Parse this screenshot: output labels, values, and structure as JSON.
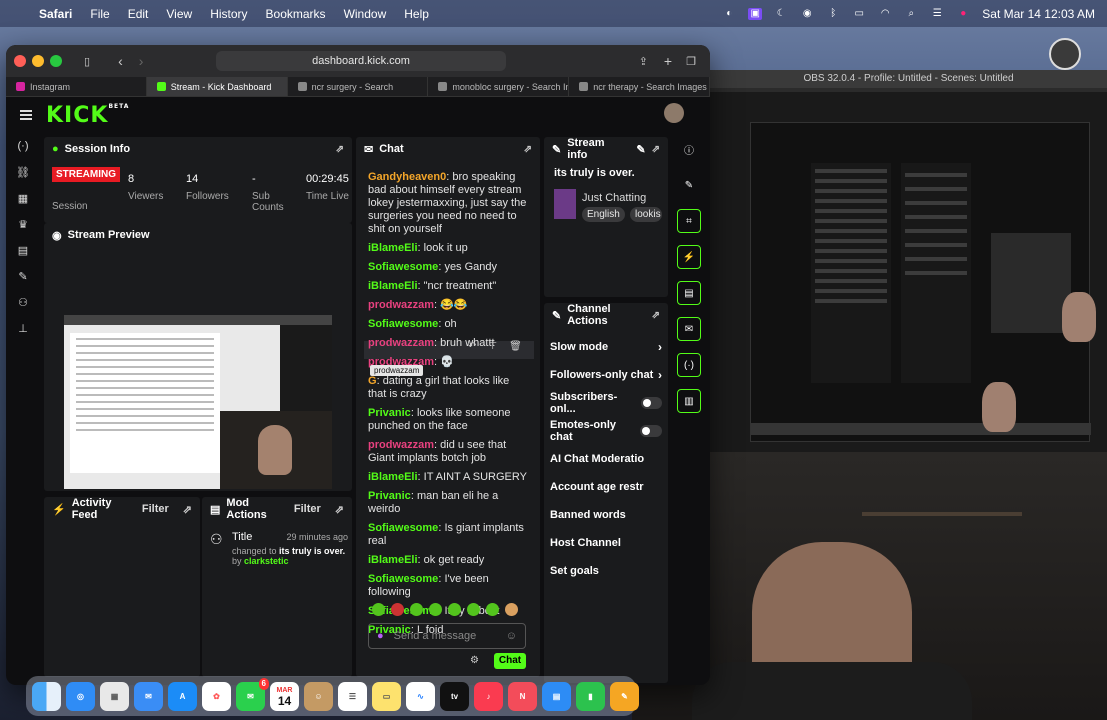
{
  "menubar": {
    "app": "Safari",
    "items": [
      "File",
      "Edit",
      "View",
      "History",
      "Bookmarks",
      "Window",
      "Help"
    ],
    "datetime": "Sat Mar 14  12:03 AM"
  },
  "safari": {
    "url": "dashboard.kick.com",
    "tabs": [
      {
        "label": "Instagram",
        "color": "#d6249f"
      },
      {
        "label": "Stream - Kick Dashboard",
        "color": "#53fc18"
      },
      {
        "label": "ncr surgery - Search",
        "color": "#888"
      },
      {
        "label": "monobloc surgery - Search Im...",
        "color": "#888"
      },
      {
        "label": "ncr therapy - Search Images",
        "color": "#888"
      }
    ]
  },
  "obs": {
    "title": "OBS 32.0.4 - Profile: Untitled - Scenes: Untitled"
  },
  "kick": {
    "logo": "KICK",
    "logo_sup": "BETA"
  },
  "session": {
    "title": "Session Info",
    "status": "STREAMING",
    "status_label": "Session",
    "viewers_value": "8",
    "viewers_label": "Viewers",
    "followers_value": "14",
    "followers_label": "Followers",
    "subs_value": "-",
    "subs_label": "Sub Counts",
    "time_value": "00:29:45",
    "time_label": "Time Live"
  },
  "preview": {
    "title": "Stream Preview"
  },
  "activity": {
    "title": "Activity Feed",
    "filter": "Filter"
  },
  "mod": {
    "title": "Mod Actions",
    "filter": "Filter",
    "item_title": "Title",
    "item_time": "29 minutes ago",
    "item_prefix": "changed to ",
    "item_value": "its truly is over.",
    "item_by_prefix": "by ",
    "item_by": "clarkstetic"
  },
  "chat": {
    "title": "Chat",
    "messages": [
      {
        "user": "Gandyheaven0",
        "color": "#f4a62a",
        "text": "bro speaking bad about himself every stream lokey jestermaxxing, just say the surgeries you need no need to shit on yourself"
      },
      {
        "user": "iBlameEli",
        "color": "#53fc18",
        "text": "look it up"
      },
      {
        "user": "Sofiawesome",
        "color": "#53fc18",
        "text": "yes Gandy"
      },
      {
        "user": "iBlameEli",
        "color": "#53fc18",
        "text": "\"ncr treatment\""
      },
      {
        "user": "prodwazzam",
        "color": "#e8417f",
        "text": "😂😂"
      },
      {
        "user": "Sofiawesome",
        "color": "#53fc18",
        "text": "oh"
      },
      {
        "user": "prodwazzam",
        "color": "#e8417f",
        "text": "bruh whattt"
      },
      {
        "user": "prodwazzam",
        "color": "#e8417f",
        "text": "💀"
      },
      {
        "user": "G",
        "color": "#f4a62a",
        "text": "dating a girl that looks like that is crazy"
      },
      {
        "user": "Privanic",
        "color": "#53fc18",
        "text": "looks like someone punched on the face"
      },
      {
        "user": "prodwazzam",
        "color": "#e8417f",
        "text": "did u see that Giant implants botch job"
      },
      {
        "user": "iBlameEli",
        "color": "#53fc18",
        "text": "IT AINT A SURGERY"
      },
      {
        "user": "Privanic",
        "color": "#53fc18",
        "text": "man ban eli he a weirdo"
      },
      {
        "user": "Sofiawesome",
        "color": "#53fc18",
        "text": "Is giant implants real"
      },
      {
        "user": "iBlameEli",
        "color": "#53fc18",
        "text": "ok get ready"
      },
      {
        "user": "Sofiawesome",
        "color": "#53fc18",
        "text": "I've been following"
      },
      {
        "user": "Sofiawesome",
        "color": "#53fc18",
        "text": "Italy is best"
      },
      {
        "user": "Privanic",
        "color": "#53fc18",
        "text": "L foid"
      }
    ],
    "tooltip": "prodwazzam",
    "placeholder": "Send a message",
    "send": "Chat"
  },
  "streaminfo": {
    "title": "Stream info",
    "stream_title": "its truly is over.",
    "category": "Just Chatting",
    "tag1": "English",
    "tag2": "lookis"
  },
  "channel_actions": {
    "title": "Channel Actions",
    "items": [
      {
        "label": "Slow mode",
        "kind": "arrow"
      },
      {
        "label": "Followers-only chat",
        "kind": "arrow"
      },
      {
        "label": "Subscribers-onl...",
        "kind": "toggle"
      },
      {
        "label": "Emotes-only chat",
        "kind": "toggle"
      },
      {
        "label": "AI Chat Moderatio",
        "kind": "none"
      },
      {
        "label": "Account age restr",
        "kind": "none"
      },
      {
        "label": "Banned words",
        "kind": "none"
      },
      {
        "label": "Host Channel",
        "kind": "none"
      },
      {
        "label": "Set goals",
        "kind": "none"
      }
    ]
  },
  "dock": {
    "calendar_month": "MAR",
    "calendar_day": "14",
    "messages_badge": "6"
  }
}
